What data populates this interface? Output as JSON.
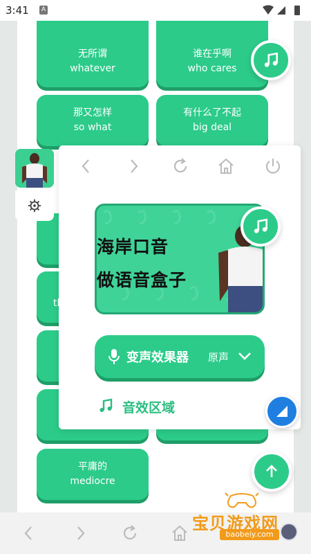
{
  "status_bar": {
    "time": "3:41",
    "notification_badge": "A"
  },
  "cards": [
    {
      "zh": "无所谓",
      "en": "whatever"
    },
    {
      "zh": "谁在乎啊",
      "en": "who cares"
    },
    {
      "zh": "那又怎样",
      "en": "so what"
    },
    {
      "zh": "有什么了不起",
      "en": "big deal"
    },
    {
      "zh": "平庸的",
      "en": "mediocre"
    }
  ],
  "partial_card_text": "th",
  "panel": {
    "banner": {
      "line1": "海岸口音",
      "line2": "做语音盒子"
    },
    "voice_changer": {
      "label": "变声效果器",
      "value": "原声"
    },
    "section_title": "音效区域"
  },
  "watermark": {
    "name": "宝贝游戏网",
    "url": "baobeiy.com"
  },
  "colors": {
    "accent": "#2ccb8a",
    "accent_dark": "#1f9e68",
    "blue_button": "#1e7fe0",
    "watermark": "#f29a1a"
  }
}
